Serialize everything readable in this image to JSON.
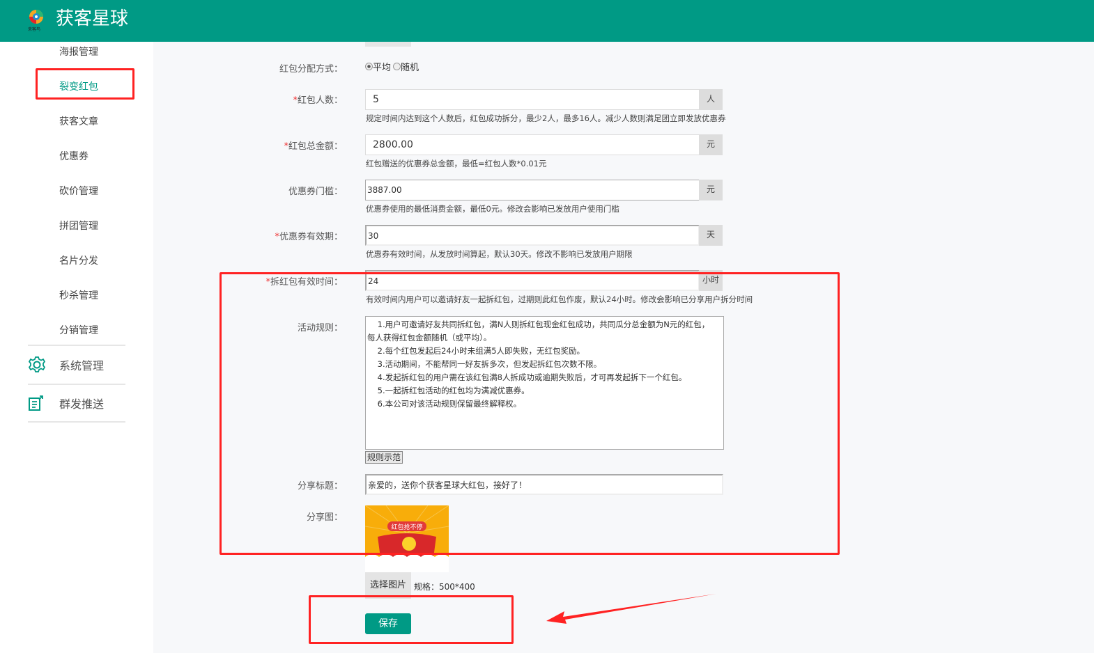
{
  "header": {
    "title": "获客星球",
    "logo_text": "来客鸟"
  },
  "sidebar": {
    "items": [
      {
        "label": "海报管理"
      },
      {
        "label": "裂变红包"
      },
      {
        "label": "获客文章"
      },
      {
        "label": "优惠券"
      },
      {
        "label": "砍价管理"
      },
      {
        "label": "拼团管理"
      },
      {
        "label": "名片分发"
      },
      {
        "label": "秒杀管理"
      },
      {
        "label": "分销管理"
      }
    ],
    "groups": [
      {
        "label": "系统管理",
        "icon": "gear-icon"
      },
      {
        "label": "群发推送",
        "icon": "publish-icon"
      }
    ]
  },
  "form": {
    "distribution": {
      "label": "红包分配方式：",
      "options": [
        "平均",
        "随机"
      ],
      "selected": "平均"
    },
    "count": {
      "label": "红包人数：",
      "value": "5",
      "unit": "人",
      "hint": "规定时间内达到这个人数后，红包成功拆分，最少2人，最多16人。减少人数则满足团立即发放优惠券"
    },
    "total": {
      "label": "红包总金额：",
      "value": "2800.00",
      "unit": "元",
      "hint": "红包赠送的优惠券总金额，最低=红包人数*0.01元"
    },
    "threshold": {
      "label": "优惠券门槛：",
      "value": "3887.00",
      "unit": "元",
      "hint": "优惠券使用的最低消费金额，最低0元。修改会影响已发放用户使用门槛"
    },
    "validity": {
      "label": "优惠券有效期：",
      "value": "30",
      "unit": "天",
      "hint": "优惠券有效时间，从发放时间算起，默认30天。修改不影响已发放用户期限"
    },
    "open_time": {
      "label": "拆红包有效时间：",
      "value": "24",
      "unit": "小时",
      "hint": "有效时间内用户可以邀请好友一起拆红包，过期则此红包作废，默认24小时。修改会影响已分享用户拆分时间"
    },
    "rules": {
      "label": "活动规则：",
      "lines": [
        "    1.用户可邀请好友共同拆红包，满N人则拆红包现金红包成功，共同瓜分总金额为N元的红包，",
        "每人获得红包金额随机（或平均）。",
        "    2.每个红包发起后24小时未组满5人即失败，无红包奖励。",
        "    3.活动期间，不能帮同一好友拆多次，但发起拆红包次数不限。",
        "    4.发起拆红包的用户需在该红包满8人拆成功或逾期失败后，才可再发起拆下一个红包。",
        "    5.一起拆红包活动的红包均为满减优惠券。",
        "    6.本公司对该活动规则保留最终解释权。"
      ],
      "example_button": "规则示范"
    },
    "share_title": {
      "label": "分享标题：",
      "value": "亲爱的，送你个获客星球大红包，接好了！"
    },
    "share_image": {
      "label": "分享图：",
      "image_text": "红包抢不停",
      "choose_button": "选择图片",
      "spec": "规格：500*400"
    },
    "save_button": "保存"
  },
  "colors": {
    "brand": "#009a85",
    "annotation": "#ff2222"
  }
}
